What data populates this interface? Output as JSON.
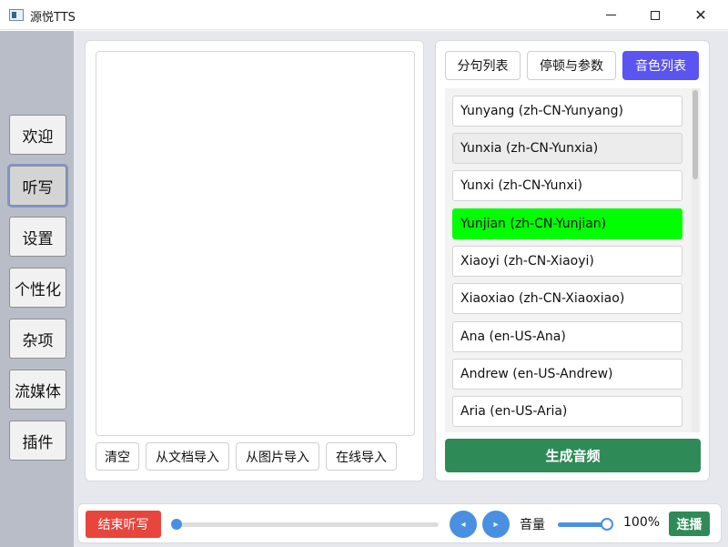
{
  "window": {
    "title": "源悦TTS",
    "minimize_icon": "minimize-icon",
    "maximize_icon": "maximize-icon",
    "close_icon": "close-icon",
    "close_glyph": "✕"
  },
  "sidebar": {
    "items": [
      {
        "label": "欢迎"
      },
      {
        "label": "听写",
        "active": true
      },
      {
        "label": "设置"
      },
      {
        "label": "个性化"
      },
      {
        "label": "杂项"
      },
      {
        "label": "流媒体"
      },
      {
        "label": "插件"
      }
    ]
  },
  "editor": {
    "text": "",
    "buttons": [
      {
        "label": "清空"
      },
      {
        "label": "从文档导入"
      },
      {
        "label": "从图片导入"
      },
      {
        "label": "在线导入"
      }
    ]
  },
  "right_panel": {
    "tabs": [
      {
        "label": "分句列表"
      },
      {
        "label": "停顿与参数"
      },
      {
        "label": "音色列表",
        "selected": true
      }
    ],
    "voices": [
      {
        "label": "Yunyang (zh-CN-Yunyang)"
      },
      {
        "label": "Yunxia (zh-CN-Yunxia)",
        "state": "hover"
      },
      {
        "label": "Yunxi (zh-CN-Yunxi)"
      },
      {
        "label": "Yunjian (zh-CN-Yunjian)",
        "state": "current"
      },
      {
        "label": "Xiaoyi (zh-CN-Xiaoyi)"
      },
      {
        "label": "Xiaoxiao (zh-CN-Xiaoxiao)"
      },
      {
        "label": "Ana (en-US-Ana)"
      },
      {
        "label": "Andrew (en-US-Andrew)"
      },
      {
        "label": "Aria (en-US-Aria)"
      }
    ],
    "generate_label": "生成音频"
  },
  "player": {
    "stop_label": "结束听写",
    "progress": 0,
    "prev_glyph": "◂",
    "next_glyph": "▸",
    "volume_label": "音量",
    "volume": 1.0,
    "volume_value": "100%",
    "continuous_label": "连播"
  },
  "colors": {
    "accent": "#5a54f0",
    "generate": "#2e8b57",
    "stop": "#e8453c",
    "current_voice": "#00ff00",
    "player_blue": "#4a90e2"
  }
}
